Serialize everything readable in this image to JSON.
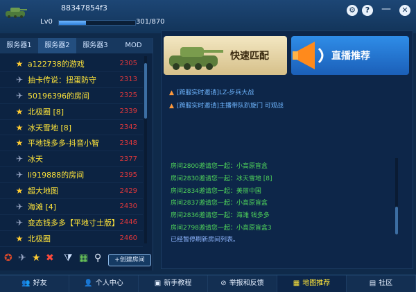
{
  "header": {
    "user_id": "88347854f3",
    "level": "Lv0",
    "xp": "301/870",
    "xp_progress": 0.35
  },
  "server_tabs": [
    "服务器1",
    "服务器2",
    "服务器3",
    "MOD"
  ],
  "rooms": [
    {
      "icon": "star",
      "name": "a122738的游戏",
      "count": "2305"
    },
    {
      "icon": "jet",
      "name": "抽卡传说：扭蛋防守",
      "count": "2313"
    },
    {
      "icon": "jet",
      "name": "50196396的房间",
      "count": "2325"
    },
    {
      "icon": "star",
      "name": "北极圈 [8]",
      "count": "2339"
    },
    {
      "icon": "star",
      "name": "冰天雪地 [8]",
      "count": "2342"
    },
    {
      "icon": "star",
      "name": "平地钱多多-抖音小智",
      "count": "2348"
    },
    {
      "icon": "jet",
      "name": "冰天",
      "count": "2377"
    },
    {
      "icon": "jet",
      "name": "li919888的房间",
      "count": "2395"
    },
    {
      "icon": "star",
      "name": "超大地图",
      "count": "2429"
    },
    {
      "icon": "jet",
      "name": "海滩 [4]",
      "count": "2430"
    },
    {
      "icon": "jet",
      "name": "变态钱多多【平地寸土版】",
      "count": "2446"
    },
    {
      "icon": "star",
      "name": "北极圈",
      "count": "2460"
    }
  ],
  "toolbar": {
    "create_room": "+创建房间"
  },
  "banners": {
    "quick_match": "快速匹配",
    "live": "直播推荐"
  },
  "messages": [
    "[跨服实时邀请]LZ-步兵大战",
    "[跨服实时邀请]主播带队趴旋门 可观战"
  ],
  "invites": [
    "房间2800邀请您一起：小高原盲盒",
    "房间2830邀请您一起：冰天雪地 [8]",
    "房间2834邀请您一起：美丽中国",
    "房间2837邀请您一起：小高原盲盒",
    "房间2836邀请您一起：海滩 钱多多",
    "房间2798邀请您一起：小高原盲盒3"
  ],
  "refresh_note": "已经暂停刷新房间列表。",
  "bottom_nav": [
    "好友",
    "个人中心",
    "新手教程",
    "举报和反馈",
    "地图推荐",
    "社区"
  ],
  "colors": {
    "room_name": "#ffe53a",
    "room_count": "#e0373b",
    "invite_text": "#4fd45a",
    "message_text": "#6fb6ff"
  }
}
